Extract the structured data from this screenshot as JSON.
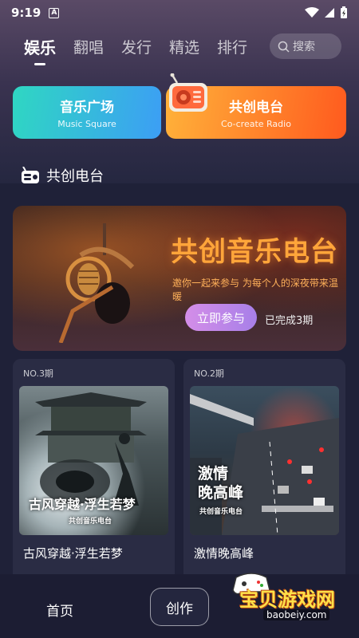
{
  "status": {
    "time": "9:19",
    "badge": "A"
  },
  "nav": {
    "tabs": [
      {
        "label": "娱乐",
        "active": true
      },
      {
        "label": "翻唱",
        "active": false
      },
      {
        "label": "发行",
        "active": false
      },
      {
        "label": "精选",
        "active": false
      },
      {
        "label": "排行",
        "active": false
      }
    ],
    "search_placeholder": "搜索"
  },
  "cards": {
    "music": {
      "title": "音乐广场",
      "subtitle": "Music Square"
    },
    "radio": {
      "title": "共创电台",
      "subtitle": "Co-create Radio"
    }
  },
  "section": {
    "title": "共创电台"
  },
  "banner": {
    "title": "共创音乐电台",
    "subtitle": "邀你一起来参与  为每个人的深夜带来温暖",
    "join_label": "立即参与",
    "done_text": "已完成3期"
  },
  "episodes": [
    {
      "num": "NO.3期",
      "title": "古风穿越·浮生若梦",
      "art_caption": "古风穿越·浮生若梦",
      "art_sub": "共创音乐电台"
    },
    {
      "num": "NO.2期",
      "title": "激情晚高峰",
      "art_caption_line1": "激情",
      "art_caption_line2": "晚高峰",
      "art_sub": "共创音乐电台"
    }
  ],
  "bottom": {
    "home_label": "首页",
    "create_label": "创作"
  },
  "watermark": {
    "text": "宝贝游戏网",
    "url": "baobeiy.com"
  },
  "colors": {
    "background": "#1f2138",
    "accent_orange": "#ff5a1e",
    "accent_teal": "#2fd7c2",
    "join_purple": "#c088e8"
  }
}
